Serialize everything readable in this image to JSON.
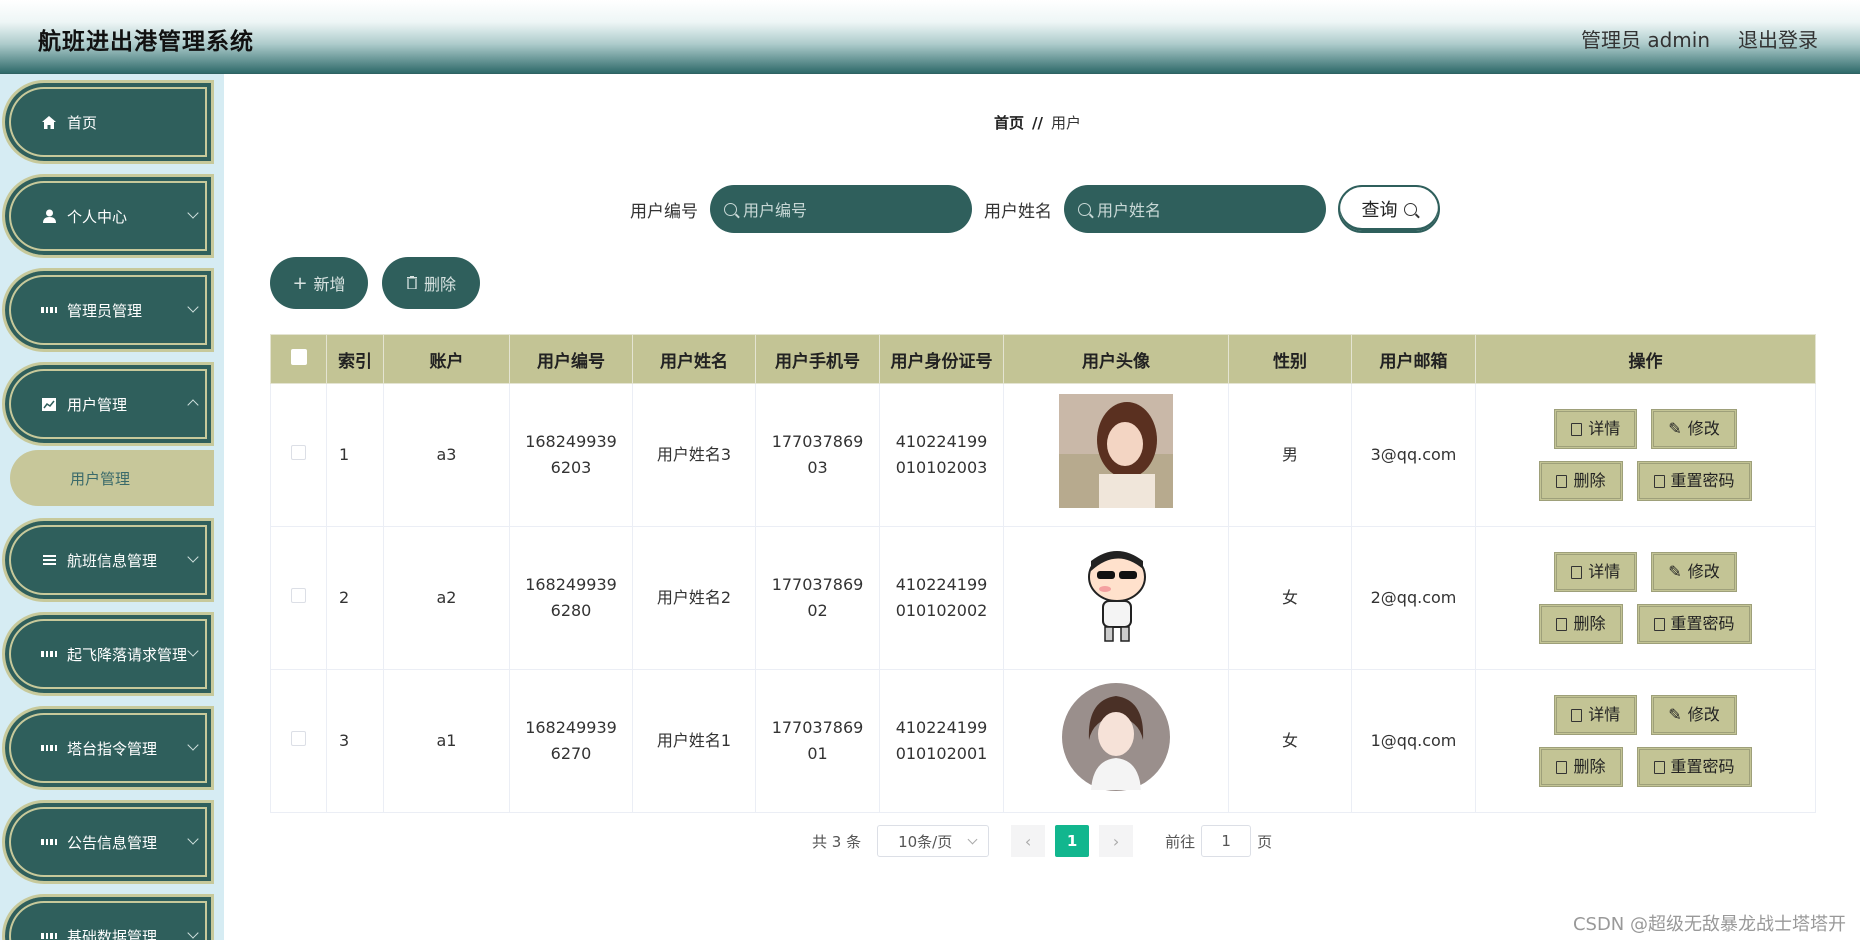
{
  "header": {
    "title": "航班进出港管理系统",
    "admin_label": "管理员 admin",
    "logout_label": "退出登录"
  },
  "sidebar": {
    "items": [
      {
        "label": "首页",
        "icon": "home-icon"
      },
      {
        "label": "个人中心",
        "icon": "user-icon"
      },
      {
        "label": "管理员管理",
        "icon": "grid-icon"
      },
      {
        "label": "用户管理",
        "icon": "chart-icon"
      },
      {
        "label": "航班信息管理",
        "icon": "list-icon"
      },
      {
        "label": "起飞降落请求管理",
        "icon": "grid-icon"
      },
      {
        "label": "塔台指令管理",
        "icon": "grid-icon"
      },
      {
        "label": "公告信息管理",
        "icon": "grid-icon"
      },
      {
        "label": "基础数据管理",
        "icon": "grid-icon"
      }
    ],
    "active_sub": "用户管理"
  },
  "breadcrumb": {
    "home": "首页",
    "separator": "//",
    "current": "用户"
  },
  "search": {
    "field1_label": "用户编号",
    "field1_placeholder": "用户编号",
    "field2_label": "用户姓名",
    "field2_placeholder": "用户姓名",
    "query_label": "查询"
  },
  "actions": {
    "add_label": "新增",
    "delete_label": "删除"
  },
  "table": {
    "headers": [
      "索引",
      "账户",
      "用户编号",
      "用户姓名",
      "用户手机号",
      "用户身份证号",
      "用户头像",
      "性别",
      "用户邮箱",
      "操作"
    ],
    "rows": [
      {
        "index": "1",
        "account": "a3",
        "user_no": "1682499396203",
        "name": "用户姓名3",
        "phone": "17703786903",
        "id_card": "410224199010102003",
        "gender": "男",
        "email": "3@qq.com",
        "avatar": "photo-avatar"
      },
      {
        "index": "2",
        "account": "a2",
        "user_no": "1682499396280",
        "name": "用户姓名2",
        "phone": "17703786902",
        "id_card": "410224199010102002",
        "gender": "女",
        "email": "2@qq.com",
        "avatar": "cartoon-avatar"
      },
      {
        "index": "3",
        "account": "a1",
        "user_no": "1682499396270",
        "name": "用户姓名1",
        "phone": "17703786901",
        "id_card": "410224199010102001",
        "gender": "女",
        "email": "1@qq.com",
        "avatar": "illustration-avatar"
      }
    ],
    "ops": {
      "detail": "详情",
      "edit": "修改",
      "delete": "删除",
      "reset": "重置密码"
    }
  },
  "pager": {
    "total": "共 3 条",
    "page_size": "10条/页",
    "current_page": "1",
    "goto_prefix": "前往",
    "goto_value": "1",
    "goto_suffix": "页"
  },
  "watermark": "CSDN @超级无敌暴龙战士塔塔开"
}
